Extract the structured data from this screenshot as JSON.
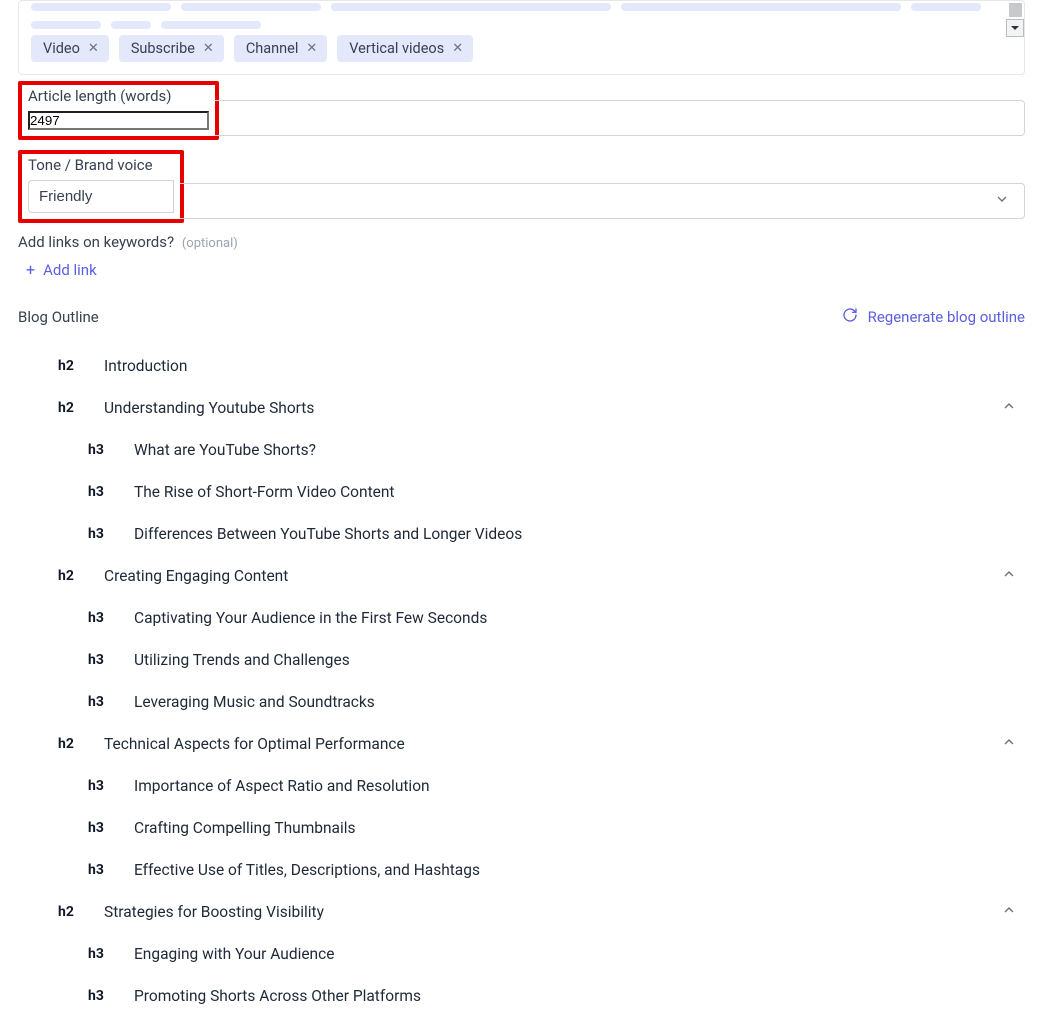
{
  "tags": {
    "row_top_placeholder_widths": [
      140,
      140,
      280,
      280,
      70,
      70,
      40,
      100
    ],
    "row2": [
      "Video",
      "Subscribe",
      "Channel",
      "Vertical videos"
    ]
  },
  "article_length": {
    "label": "Article length (words)",
    "value": "2497"
  },
  "tone": {
    "label": "Tone / Brand voice",
    "value": "Friendly"
  },
  "links": {
    "label": "Add links on keywords?",
    "optional": "(optional)",
    "add_label": "Add link"
  },
  "outline": {
    "title": "Blog Outline",
    "regen_label": "Regenerate blog outline",
    "items": [
      {
        "level": "h2",
        "title": "Introduction",
        "collapsible": false
      },
      {
        "level": "h2",
        "title": "Understanding Youtube Shorts",
        "collapsible": true
      },
      {
        "level": "h3",
        "title": "What are YouTube Shorts?"
      },
      {
        "level": "h3",
        "title": "The Rise of Short-Form Video Content"
      },
      {
        "level": "h3",
        "title": "Differences Between YouTube Shorts and Longer Videos"
      },
      {
        "level": "h2",
        "title": "Creating Engaging Content",
        "collapsible": true
      },
      {
        "level": "h3",
        "title": "Captivating Your Audience in the First Few Seconds"
      },
      {
        "level": "h3",
        "title": "Utilizing Trends and Challenges"
      },
      {
        "level": "h3",
        "title": "Leveraging Music and Soundtracks"
      },
      {
        "level": "h2",
        "title": "Technical Aspects for Optimal Performance",
        "collapsible": true
      },
      {
        "level": "h3",
        "title": "Importance of Aspect Ratio and Resolution"
      },
      {
        "level": "h3",
        "title": "Crafting Compelling Thumbnails"
      },
      {
        "level": "h3",
        "title": "Effective Use of Titles, Descriptions, and Hashtags"
      },
      {
        "level": "h2",
        "title": "Strategies for Boosting Visibility",
        "collapsible": true
      },
      {
        "level": "h3",
        "title": "Engaging with Your Audience"
      },
      {
        "level": "h3",
        "title": "Promoting Shorts Across Other Platforms"
      }
    ]
  }
}
